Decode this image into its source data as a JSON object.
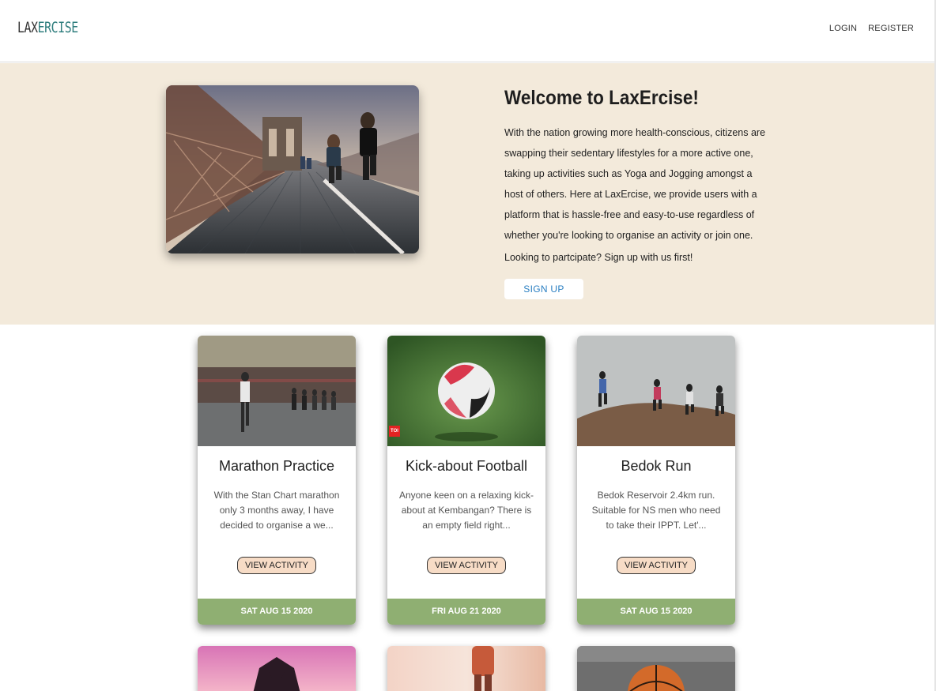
{
  "navbar": {
    "logo_part1": "LAX",
    "logo_part2": "ERCISE",
    "login_label": "LOGIN",
    "register_label": "REGISTER"
  },
  "hero": {
    "title": "Welcome to LaxErcise!",
    "paragraph": "With the nation growing more health-conscious, citizens are swapping their sedentary lifestyles for a more active one, taking up activities such as Yoga and Jogging amongst a host of others. Here at LaxErcise, we provide users with a platform that is hassle-free and easy-to-use regardless of whether you're looking to organise an activity or join one.",
    "cta_text": "Looking to partcipate? Sign up with us first!",
    "signup_label": "SIGN UP"
  },
  "activities": [
    {
      "title": "Marathon Practice",
      "description": "With the Stan Chart marathon only 3 months away, I have decided to organise a we...",
      "button_label": "VIEW ACTIVITY",
      "date": "SAT AUG 15 2020"
    },
    {
      "title": "Kick-about Football",
      "description": "Anyone keen on a relaxing kick-about at Kembangan? There is an empty field right...",
      "button_label": "VIEW ACTIVITY",
      "date": "FRI AUG 21 2020",
      "badge": "TOI"
    },
    {
      "title": "Bedok Run",
      "description": "Bedok Reservoir 2.4km run. Suitable for NS men who need to take their IPPT. Let'...",
      "button_label": "VIEW ACTIVITY",
      "date": "SAT AUG 15 2020"
    }
  ],
  "colors": {
    "hero_bg": "#f3eadb",
    "accent_teal": "#2e7d7d",
    "date_bar": "#8faf72",
    "view_btn": "#f7dcc6",
    "signup_text": "#2a7fc2"
  }
}
